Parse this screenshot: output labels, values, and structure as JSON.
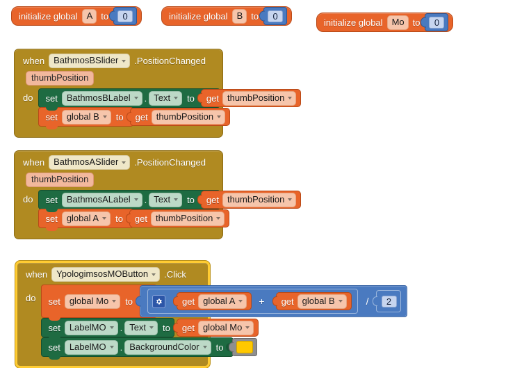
{
  "editor": {
    "name": "MIT App Inventor Blocks Editor",
    "canvas_background": "#ffffff"
  },
  "palette": {
    "variable_color": "#e8642a",
    "event_color": "#b08a21",
    "component_set_color": "#1e6b42",
    "math_color": "#4a7ac0",
    "selection_border": "#ffcc33",
    "picked_color_swatch": "#ffc800"
  },
  "global_inits": [
    {
      "keyword1": "initialize global",
      "name": "A",
      "to": "to",
      "value": "0"
    },
    {
      "keyword1": "initialize global",
      "name": "B",
      "to": "to",
      "value": "0"
    },
    {
      "keyword1": "initialize global",
      "name": "Mo",
      "to": "to",
      "value": "0"
    }
  ],
  "events": [
    {
      "when": "when",
      "component": "BathmosBSlider",
      "event": ".PositionChanged",
      "parameter": "thumbPosition",
      "do_label": "do",
      "selected": false,
      "statements": [
        {
          "type": "set-component",
          "set": "set",
          "component": "BathmosBLabel",
          "dot": ".",
          "property": "Text",
          "to": "to",
          "value": {
            "type": "get",
            "get": "get",
            "name": "thumbPosition"
          }
        },
        {
          "type": "set-variable",
          "set": "set",
          "variable": "global B",
          "to": "to",
          "value": {
            "type": "get",
            "get": "get",
            "name": "thumbPosition"
          }
        }
      ]
    },
    {
      "when": "when",
      "component": "BathmosASlider",
      "event": ".PositionChanged",
      "parameter": "thumbPosition",
      "do_label": "do",
      "selected": false,
      "statements": [
        {
          "type": "set-component",
          "set": "set",
          "component": "BathmosALabel",
          "dot": ".",
          "property": "Text",
          "to": "to",
          "value": {
            "type": "get",
            "get": "get",
            "name": "thumbPosition"
          }
        },
        {
          "type": "set-variable",
          "set": "set",
          "variable": "global A",
          "to": "to",
          "value": {
            "type": "get",
            "get": "get",
            "name": "thumbPosition"
          }
        }
      ]
    },
    {
      "when": "when",
      "component": "YpologimsosMOButton",
      "event": ".Click",
      "parameter": null,
      "do_label": "do",
      "selected": true,
      "statements": [
        {
          "type": "set-variable-math",
          "set": "set",
          "variable": "global Mo",
          "to": "to",
          "expression": {
            "type": "divide",
            "operator": "/",
            "mutator_icon": "gear-icon",
            "left": {
              "type": "add",
              "operator": "+",
              "operands": [
                {
                  "type": "get",
                  "get": "get",
                  "name": "global A"
                },
                {
                  "type": "get",
                  "get": "get",
                  "name": "global B"
                }
              ]
            },
            "right": {
              "type": "number",
              "value": "2"
            }
          }
        },
        {
          "type": "set-component",
          "set": "set",
          "component": "LabelMO",
          "dot": ".",
          "property": "Text",
          "to": "to",
          "value": {
            "type": "get",
            "get": "get",
            "name": "global Mo"
          }
        },
        {
          "type": "set-component-color",
          "set": "set",
          "component": "LabelMO",
          "dot": ".",
          "property": "BackgroundColor",
          "to": "to",
          "value": {
            "type": "color",
            "hex": "#ffc800"
          }
        }
      ]
    }
  ]
}
